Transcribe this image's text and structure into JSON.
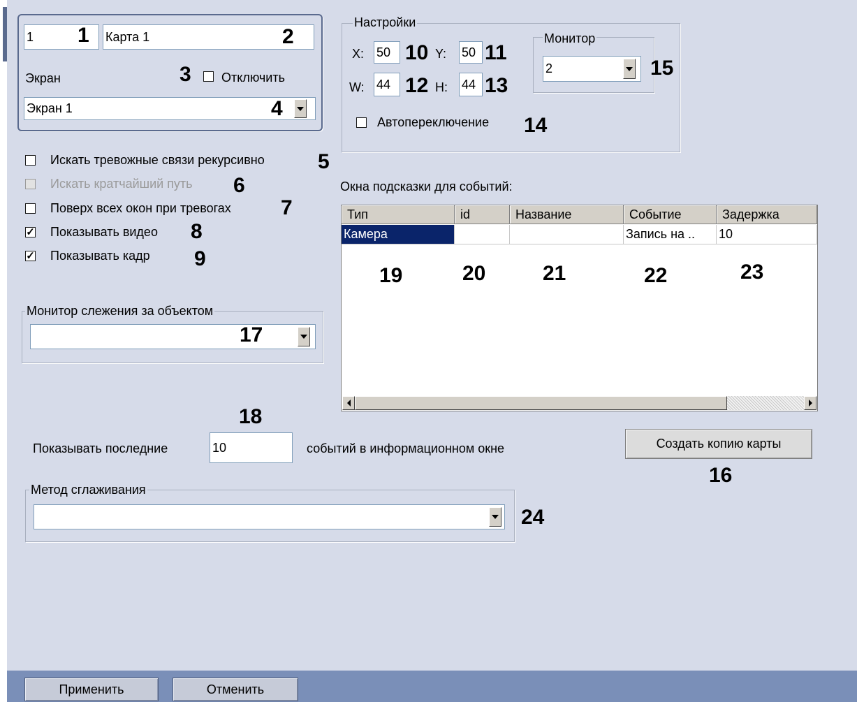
{
  "map": {
    "id": "1",
    "name": "Карта 1",
    "screen_label": "Экран",
    "disable_label": "Отключить",
    "screen_value": "Экран 1"
  },
  "options": {
    "search_recursive": "Искать тревожные связи рекурсивно",
    "search_shortest": "Искать кратчайший путь",
    "on_top_alarm": "Поверх всех окон при тревогах",
    "show_video": "Показывать видео",
    "show_frame": "Показывать кадр"
  },
  "settings": {
    "title": "Настройки",
    "x_label": "X:",
    "x_value": "50",
    "y_label": "Y:",
    "y_value": "50",
    "w_label": "W:",
    "w_value": "44",
    "h_label": "H:",
    "h_value": "44",
    "autoswitch_label": "Автопереключение",
    "monitor_title": "Монитор",
    "monitor_value": "2"
  },
  "events_table": {
    "title": "Окна подсказки для событий:",
    "columns": [
      "Тип",
      "id",
      "Название",
      "Событие",
      "Задержка"
    ],
    "rows": [
      [
        "Камера",
        "",
        "",
        "Запись на ..",
        "10"
      ]
    ]
  },
  "tracking": {
    "title": "Монитор слежения за объектом",
    "value": ""
  },
  "last_events": {
    "prefix": "Показывать последние",
    "value": "10",
    "suffix": "событий в информационном окне"
  },
  "copy_map_button": "Создать копию карты",
  "smoothing": {
    "title": "Метод сглаживания",
    "value": ""
  },
  "footer": {
    "apply": "Применить",
    "cancel": "Отменить"
  },
  "callouts": {
    "n1": "1",
    "n2": "2",
    "n3": "3",
    "n4": "4",
    "n5": "5",
    "n6": "6",
    "n7": "7",
    "n8": "8",
    "n9": "9",
    "n10": "10",
    "n11": "11",
    "n12": "12",
    "n13": "13",
    "n14": "14",
    "n15": "15",
    "n16": "16",
    "n17": "17",
    "n18": "18",
    "n19": "19",
    "n20": "20",
    "n21": "21",
    "n22": "22",
    "n23": "23",
    "n24": "24"
  },
  "checkbox_states": {
    "disable": false,
    "search_recursive": false,
    "search_shortest": false,
    "on_top_alarm": false,
    "show_video": true,
    "show_frame": true,
    "autoswitch": false
  }
}
